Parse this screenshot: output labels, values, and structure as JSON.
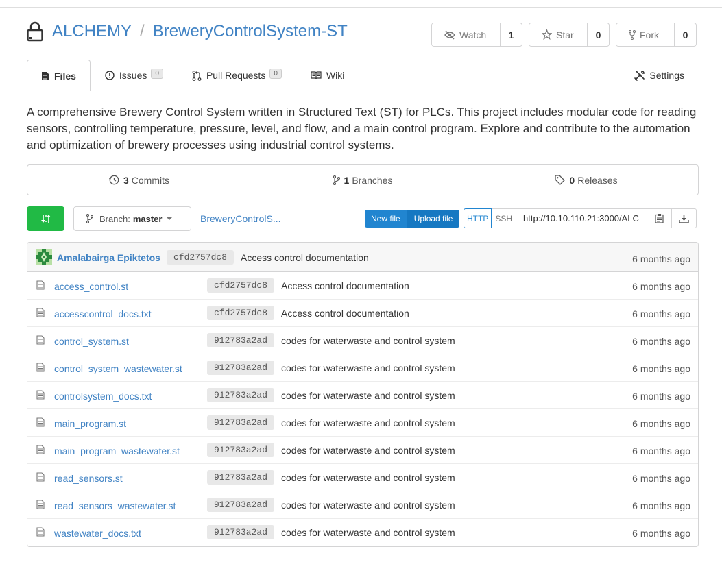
{
  "repo": {
    "owner": "ALCHEMY",
    "separator": "/",
    "name": "BreweryControlSystem-ST"
  },
  "actions": {
    "watch_label": "Watch",
    "watch_count": "1",
    "star_label": "Star",
    "star_count": "0",
    "fork_label": "Fork",
    "fork_count": "0"
  },
  "tabs": [
    {
      "label": "Files",
      "badge": ""
    },
    {
      "label": "Issues",
      "badge": "0"
    },
    {
      "label": "Pull Requests",
      "badge": "0"
    },
    {
      "label": "Wiki",
      "badge": ""
    }
  ],
  "settings_label": "Settings",
  "description": "A comprehensive Brewery Control System written in Structured Text (ST) for PLCs. This project includes modular code for reading sensors, controlling temperature, pressure, level, and flow, and a main control program. Explore and contribute to the automation and optimization of brewery processes using industrial control systems.",
  "stats": {
    "commits_count": "3",
    "commits_label": "Commits",
    "branches_count": "1",
    "branches_label": "Branches",
    "releases_count": "0",
    "releases_label": "Releases"
  },
  "branch": {
    "prefix": "Branch:",
    "name": "master",
    "breadcrumb": "BreweryControlS..."
  },
  "file_buttons": {
    "new_file": "New file",
    "upload_file": "Upload file"
  },
  "clone": {
    "http_label": "HTTP",
    "ssh_label": "SSH",
    "url": "http://10.10.110.21:3000/ALC"
  },
  "latest_commit": {
    "author": "Amalabairga Epiktetos",
    "sha": "cfd2757dc8",
    "message": "Access control documentation",
    "age": "6 months ago"
  },
  "files": [
    {
      "name": "access_control.st",
      "sha": "cfd2757dc8",
      "message": "Access control documentation",
      "age": "6 months ago"
    },
    {
      "name": "accesscontrol_docs.txt",
      "sha": "cfd2757dc8",
      "message": "Access control documentation",
      "age": "6 months ago"
    },
    {
      "name": "control_system.st",
      "sha": "912783a2ad",
      "message": "codes for waterwaste and control system",
      "age": "6 months ago"
    },
    {
      "name": "control_system_wastewater.st",
      "sha": "912783a2ad",
      "message": "codes for waterwaste and control system",
      "age": "6 months ago"
    },
    {
      "name": "controlsystem_docs.txt",
      "sha": "912783a2ad",
      "message": "codes for waterwaste and control system",
      "age": "6 months ago"
    },
    {
      "name": "main_program.st",
      "sha": "912783a2ad",
      "message": "codes for waterwaste and control system",
      "age": "6 months ago"
    },
    {
      "name": "main_program_wastewater.st",
      "sha": "912783a2ad",
      "message": "codes for waterwaste and control system",
      "age": "6 months ago"
    },
    {
      "name": "read_sensors.st",
      "sha": "912783a2ad",
      "message": "codes for waterwaste and control system",
      "age": "6 months ago"
    },
    {
      "name": "read_sensors_wastewater.st",
      "sha": "912783a2ad",
      "message": "codes for waterwaste and control system",
      "age": "6 months ago"
    },
    {
      "name": "wastewater_docs.txt",
      "sha": "912783a2ad",
      "message": "codes for waterwaste and control system",
      "age": "6 months ago"
    }
  ],
  "colors": {
    "link": "#4183c4",
    "green": "#21ba45",
    "blue": "#2185d0"
  }
}
